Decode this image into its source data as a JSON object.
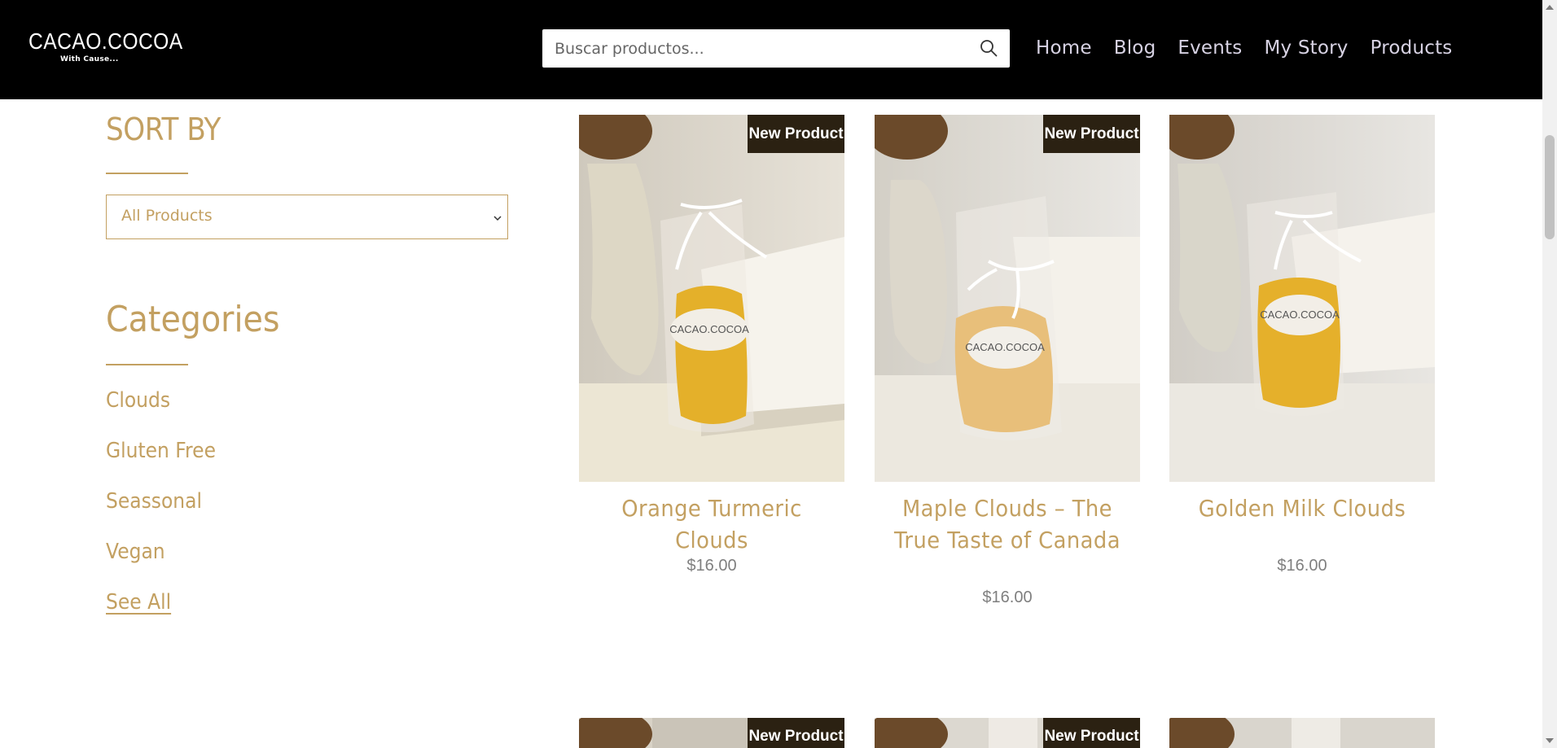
{
  "header": {
    "logo_main": "CACAO.COCOA",
    "logo_sub": "With Cause...",
    "search_placeholder": "Buscar productos...",
    "nav": [
      "Home",
      "Blog",
      "Events",
      "My Story",
      "Products"
    ]
  },
  "sidebar": {
    "sort_title": "SORT BY",
    "sort_selected": "All Products",
    "categories_title": "Categories",
    "categories": [
      "Clouds",
      "Gluten Free",
      "Seassonal",
      "Vegan"
    ],
    "see_all": "See All"
  },
  "products": [
    {
      "name": "Orange Turmeric Clouds",
      "price": "$16.00",
      "badge": "New Product",
      "bag_label": "CACAO.COCOA"
    },
    {
      "name": "Maple Clouds – The True Taste of Canada",
      "price": "$16.00",
      "badge": "New Product",
      "bag_label": "CACAO.COCOA"
    },
    {
      "name": "Golden Milk Clouds",
      "price": "$16.00",
      "badge": "",
      "bag_label": "CACAO.COCOA"
    }
  ],
  "next_row_badges": [
    "New Product",
    "New Product"
  ],
  "colors": {
    "accent_gold": "#c3a061",
    "header_bg": "#000000",
    "badge_bg": "#2b2112",
    "price_gray": "#7f7f7f"
  }
}
